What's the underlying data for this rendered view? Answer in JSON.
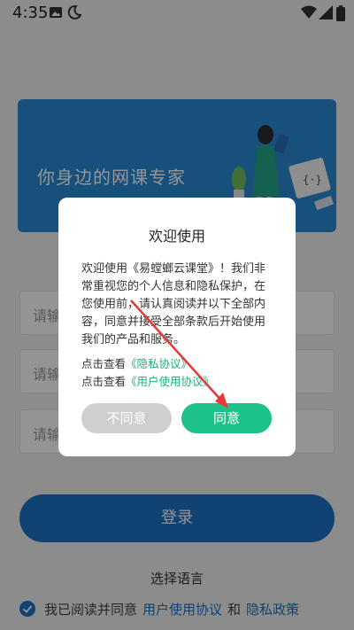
{
  "status_bar": {
    "time": "4:35"
  },
  "banner": {
    "slogan": "你身边的网课专家"
  },
  "form": {
    "field1_placeholder": "请输",
    "field2_placeholder": "请输",
    "field3_placeholder": "请输",
    "login_label": "登录",
    "language_label": "选择语言",
    "agree_text": "我已阅读并同意",
    "user_agreement_link": "用户使用协议",
    "and_text": "和",
    "privacy_link": "隐私政策"
  },
  "dialog": {
    "title": "欢迎使用",
    "body": "欢迎使用《易螳螂云课堂》！我们非常重视您的个人信息和隐私保护，在您使用前，请认真阅读并以下全部内容，同意并接受全部条款后开始使用我们的产品和服务。",
    "view_prefix_1": "点击查看",
    "privacy_agreement_link": "《隐私协议》",
    "view_prefix_2": "点击查看",
    "user_agreement_link": "《用户使用协议》",
    "disagree_label": "不同意",
    "agree_label": "同意"
  },
  "colors": {
    "accent_blue": "#1d73c9",
    "agree_green": "#1cc28a",
    "annotation_red": "#e53935"
  }
}
